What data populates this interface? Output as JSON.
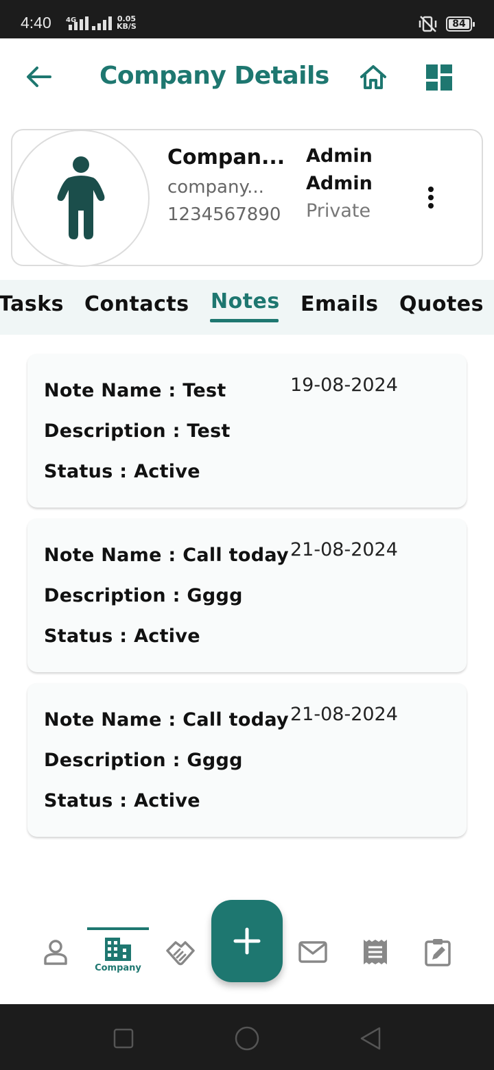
{
  "status_bar": {
    "time": "4:40",
    "network": "4G",
    "speed_value": "0.05",
    "speed_unit": "KB/S",
    "battery": "84"
  },
  "header": {
    "title": "Company Details",
    "icons": [
      "back-arrow-icon",
      "home-icon",
      "dashboard-icon"
    ]
  },
  "profile": {
    "name": "Compan...",
    "email": "company...",
    "phone": "1234567890",
    "owner_first": "Admin",
    "owner_last": "Admin",
    "visibility": "Private"
  },
  "tabs": {
    "items": [
      {
        "label": "Tasks"
      },
      {
        "label": "Contacts"
      },
      {
        "label": "Notes"
      },
      {
        "label": "Emails"
      },
      {
        "label": "Quotes"
      }
    ],
    "active": "Notes"
  },
  "notes": [
    {
      "name": "Note Name : Test",
      "description": "Description : Test",
      "status": "Status : Active",
      "date": "19-08-2024"
    },
    {
      "name": "Note Name : Call today",
      "description": "Description : Gggg",
      "status": "Status : Active",
      "date": "21-08-2024"
    },
    {
      "name": "Note Name : Call today",
      "description": "Description : Gggg",
      "status": "Status : Active",
      "date": "21-08-2024"
    }
  ],
  "bottom_nav": {
    "active_label": "Company",
    "icons": [
      "contact-icon",
      "company-icon",
      "deal-handshake-icon",
      "email-icon",
      "receipt-icon",
      "edit-note-icon"
    ],
    "fab_icon": "plus-icon"
  },
  "colors": {
    "primary": "#1e7770",
    "avatar_figure": "#1b4e4b",
    "tab_bar_bg": "#f0f6f6"
  }
}
